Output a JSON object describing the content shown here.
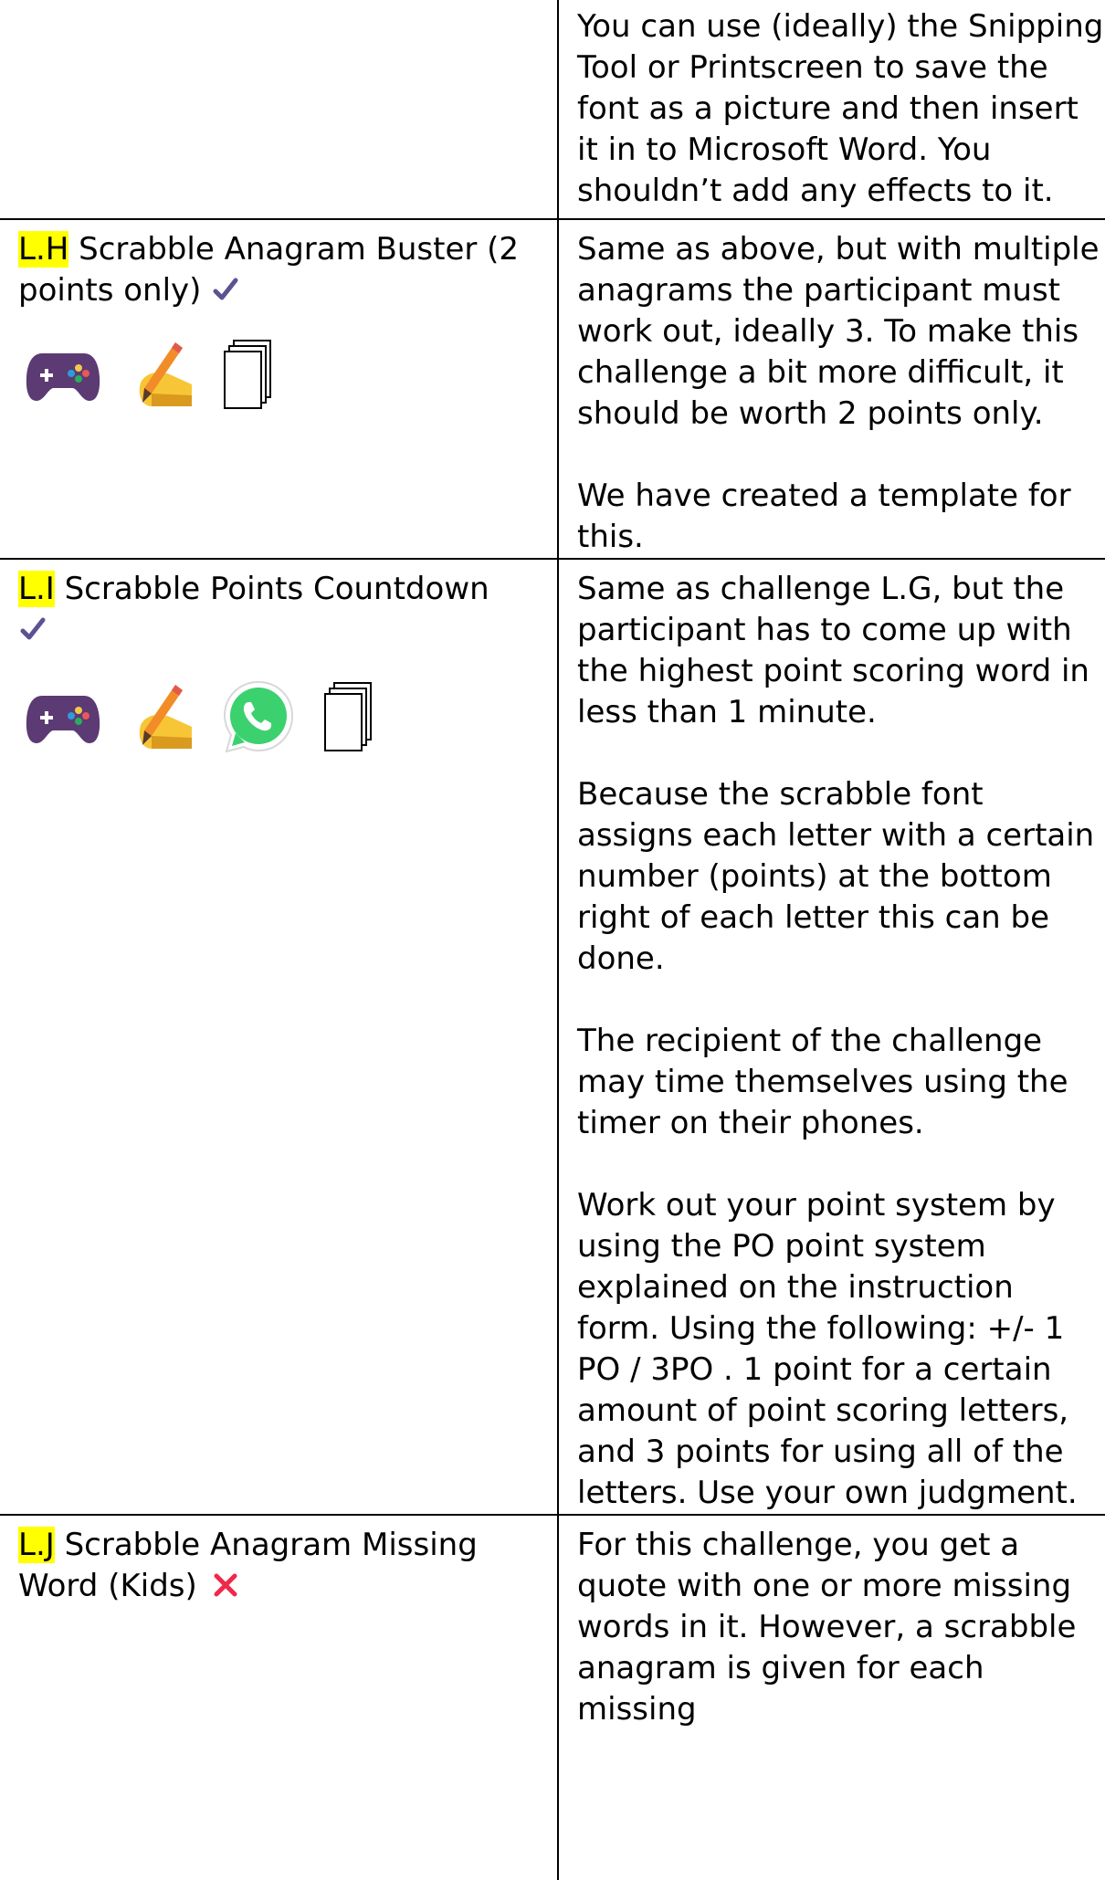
{
  "rows": [
    {
      "code": "",
      "title": "",
      "status": "",
      "icons": [],
      "description": [
        "You can use (ideally) the Snipping Tool or Printscreen to save the font as a picture and then insert it in to Microsoft Word. You shouldn’t add any effects to it."
      ]
    },
    {
      "code": "L.H",
      "title": "Scrabble Anagram Buster (2 points only)",
      "status": "check",
      "icons": [
        "game-controller-icon",
        "writing-hand-icon",
        "copy-pages-icon"
      ],
      "description": [
        "Same as above, but with multiple anagrams the participant must work out, ideally 3. To make this challenge a bit more difficult, it should be worth 2 points only.",
        "We have created a template for this."
      ]
    },
    {
      "code": "L.I",
      "title": "Scrabble Points Countdown",
      "status": "check",
      "icons": [
        "game-controller-icon",
        "writing-hand-icon",
        "whatsapp-icon",
        "copy-pages-icon"
      ],
      "description": [
        "Same as challenge L.G, but the participant has to come up with the highest point scoring word in less than 1 minute.",
        "Because the scrabble font assigns each letter with a certain number (points) at the bottom right of each letter this can be done.",
        "The recipient of the challenge may time themselves using the timer on their phones.",
        "Work out your point system by using the PO point system explained on the instruction form. Using the following: +/- 1 PO / 3PO . 1 point for a certain amount of point scoring letters, and 3 points for using all of the letters. Use your own judgment."
      ]
    },
    {
      "code": "L.J",
      "title": "Scrabble Anagram Missing Word (Kids)",
      "status": "cross",
      "icons": [],
      "description": [
        "For this challenge, you get a quote with one or more missing words in it. However, a scrabble anagram is given for each missing"
      ]
    }
  ],
  "colors": {
    "highlight": "#ffff00",
    "check": "#5b5391",
    "cross": "#f0284a",
    "controller": "#5c3a73",
    "hand": "#f7c637",
    "pencil": "#f28c28",
    "whatsapp": "#3bd16f",
    "border": "#000000"
  }
}
